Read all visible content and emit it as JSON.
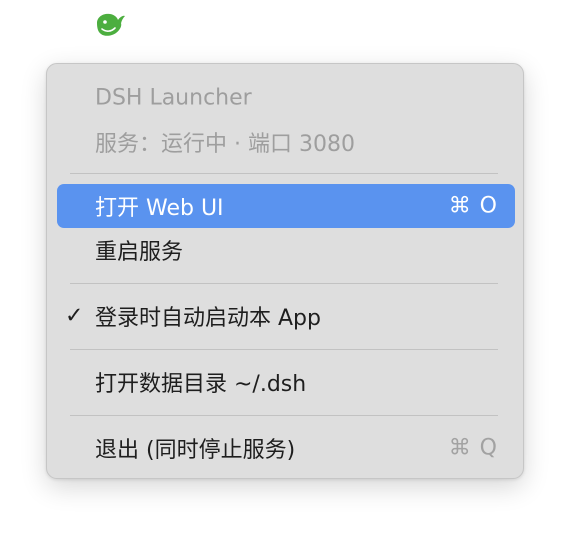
{
  "tray": {
    "icon": "green-whale-icon",
    "icon_color": "#4cae3f"
  },
  "menu": {
    "header": {
      "title": "DSH Launcher",
      "status": "服务：运行中 · 端口 3080"
    },
    "items": [
      {
        "label": "打开 Web UI",
        "shortcut": "⌘ O",
        "highlighted": true
      },
      {
        "label": "重启服务"
      },
      {
        "label": "登录时自动启动本 App",
        "checked": true,
        "check_glyph": "✓"
      },
      {
        "label": "打开数据目录 ~/.dsh"
      },
      {
        "label": "退出 (同时停止服务)",
        "shortcut": "⌘ Q"
      }
    ],
    "highlight_color": "#5a93ef"
  }
}
